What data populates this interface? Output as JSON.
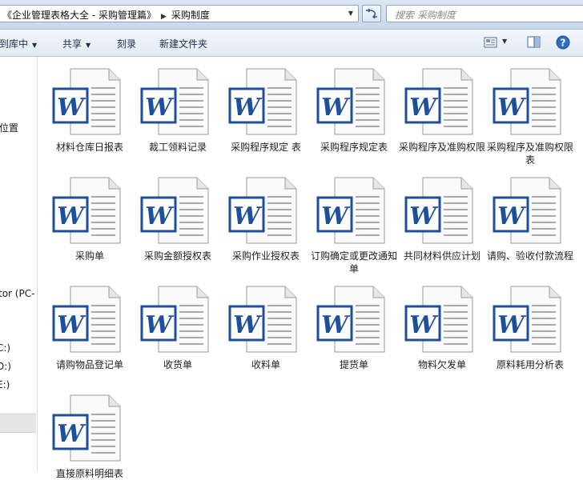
{
  "address": {
    "crumbs": [
      "《企业管理表格大全 - 采购管理篇》",
      "采购制度"
    ],
    "dropdown_icon": "chevron-down-icon",
    "refresh_icon": "refresh-icon"
  },
  "search": {
    "placeholder": "搜索 采购制度",
    "icon": "search-icon"
  },
  "toolbar": {
    "include_label": "到库中",
    "share_label": "共享",
    "burn_label": "刻录",
    "newfolder_label": "新建文件夹",
    "views_icon": "views-icon",
    "preview_icon": "preview-pane-icon",
    "help_icon": "help-icon"
  },
  "nav": {
    "items": [
      "位置",
      "tor (PC-",
      "C:)",
      "D:)",
      "E:)",
      ")"
    ]
  },
  "files": [
    {
      "name": "材料仓库日报表",
      "icon": "word-doc-icon"
    },
    {
      "name": "裁工领料记录",
      "icon": "word-doc-icon"
    },
    {
      "name": "采购程序规定 表",
      "icon": "word-doc-icon"
    },
    {
      "name": "采购程序规定表",
      "icon": "word-doc-icon"
    },
    {
      "name": "采购程序及准购权限",
      "icon": "word-doc-icon"
    },
    {
      "name": "采购程序及准购权限表",
      "icon": "word-doc-icon"
    },
    {
      "name": "采购单",
      "icon": "word-doc-icon"
    },
    {
      "name": "采购金额授权表",
      "icon": "word-doc-icon"
    },
    {
      "name": "采购作业授权表",
      "icon": "word-doc-icon"
    },
    {
      "name": "订购确定或更改通知单",
      "icon": "word-doc-icon"
    },
    {
      "name": "共同材料供应计划",
      "icon": "word-doc-icon"
    },
    {
      "name": "请购、验收付款流程",
      "icon": "word-doc-icon"
    },
    {
      "name": "请购物品登记单",
      "icon": "word-doc-icon"
    },
    {
      "name": "收货单",
      "icon": "word-doc-icon"
    },
    {
      "name": "收料单",
      "icon": "word-doc-icon"
    },
    {
      "name": "提货单",
      "icon": "word-doc-icon"
    },
    {
      "name": "物料欠发单",
      "icon": "word-doc-icon"
    },
    {
      "name": "原料耗用分析表",
      "icon": "word-doc-icon"
    },
    {
      "name": "直接原料明细表",
      "icon": "word-doc-icon"
    }
  ],
  "colors": {
    "word_blue": "#1e4f9c",
    "toolbar_text": "#1e2d4a"
  }
}
